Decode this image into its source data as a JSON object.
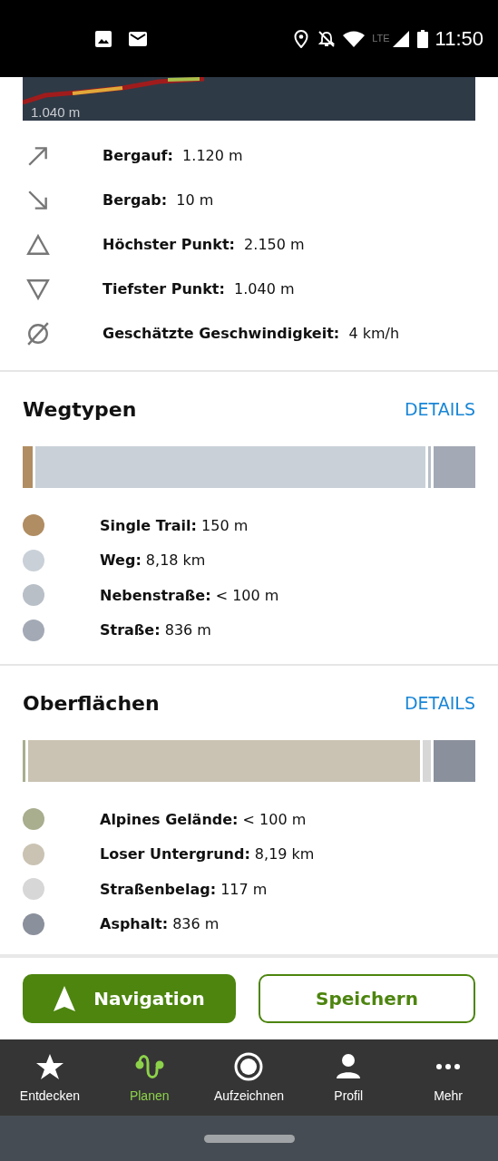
{
  "status_bar": {
    "network": "LTE",
    "time": "11:50"
  },
  "elevation": {
    "min_label": "1.040 m"
  },
  "stats": [
    {
      "kind": "up",
      "label": "Bergauf:",
      "value": "1.120 m"
    },
    {
      "kind": "down",
      "label": "Bergab:",
      "value": "10 m"
    },
    {
      "kind": "highest",
      "label": "Höchster Punkt:",
      "value": "2.150 m"
    },
    {
      "kind": "lowest",
      "label": "Tiefster Punkt:",
      "value": "1.040 m"
    },
    {
      "kind": "speed",
      "label": "Geschätzte Geschwindigkeit:",
      "value": "4 km/h"
    }
  ],
  "sections": [
    {
      "title": "Wegtypen",
      "details": "DETAILS",
      "items": [
        {
          "label": "Single Trail:",
          "value": "150 m",
          "color": "#b08d62"
        },
        {
          "label": "Weg:",
          "value": "8,18 km",
          "color": "#c9d0d8"
        },
        {
          "label": "Nebenstraße:",
          "value": "< 100 m",
          "color": "#b8bfc7"
        },
        {
          "label": "Straße:",
          "value": "836 m",
          "color": "#a3aab5"
        }
      ]
    },
    {
      "title": "Oberflächen",
      "details": "DETAILS",
      "items": [
        {
          "label": "Alpines Gelände:",
          "value": "< 100 m",
          "color": "#a8ae8e"
        },
        {
          "label": "Loser Untergrund:",
          "value": "8,19 km",
          "color": "#cac3b3"
        },
        {
          "label": "Straßenbelag:",
          "value": "117 m",
          "color": "#d7d7d7"
        },
        {
          "label": "Asphalt:",
          "value": "836 m",
          "color": "#8a909c"
        }
      ]
    }
  ],
  "actions": [
    {
      "kind": "primary",
      "label": "Navigation"
    },
    {
      "kind": "secondary",
      "label": "Speichern"
    }
  ],
  "nav": [
    {
      "kind": "star",
      "label": "Entdecken",
      "selected": false
    },
    {
      "kind": "route",
      "label": "Planen",
      "selected": true
    },
    {
      "kind": "record",
      "label": "Aufzeichnen",
      "selected": false
    },
    {
      "kind": "person",
      "label": "Profil",
      "selected": false
    },
    {
      "kind": "more",
      "label": "Mehr",
      "selected": false
    }
  ]
}
